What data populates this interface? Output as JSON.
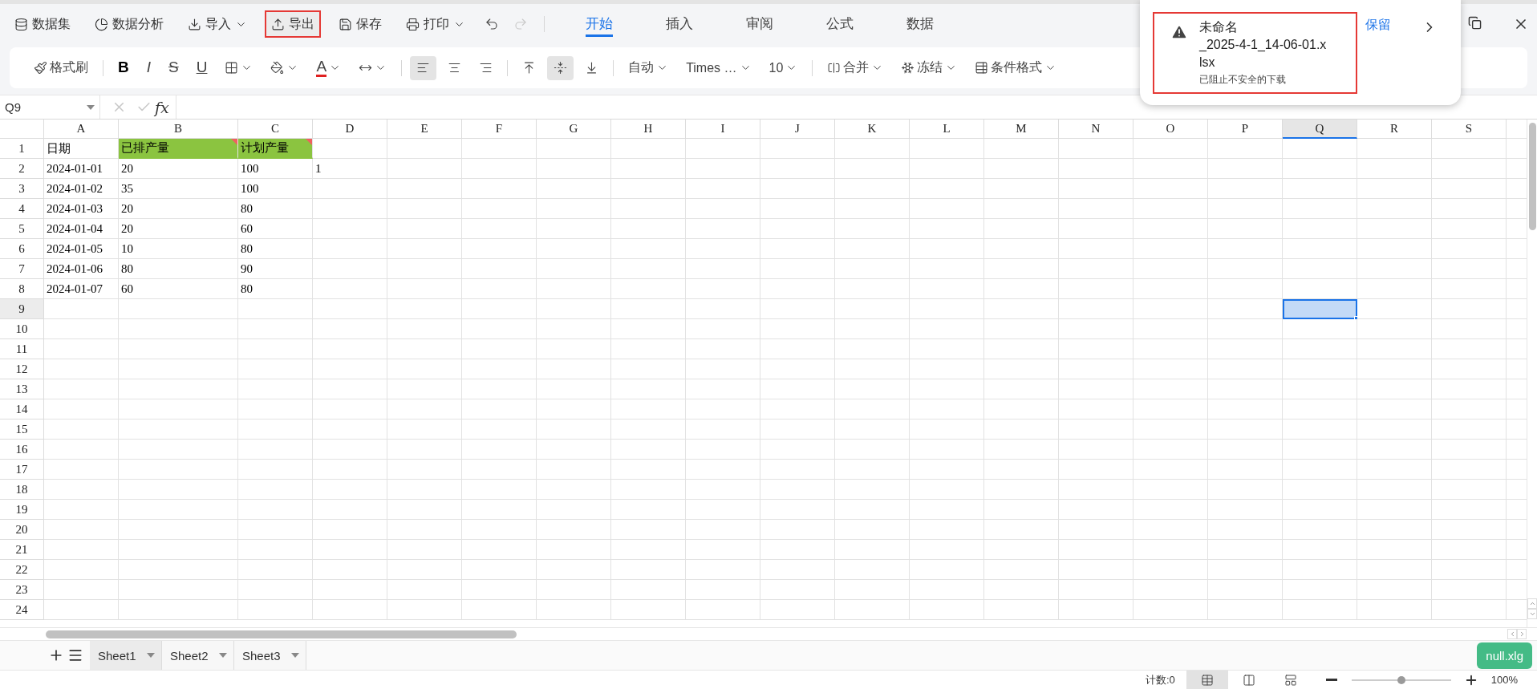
{
  "menu": [
    {
      "kind": "dataset",
      "label": "数据集",
      "dropdown": false,
      "highlighted": false
    },
    {
      "kind": "analysis",
      "label": "数据分析",
      "dropdown": false,
      "highlighted": false
    },
    {
      "kind": "import",
      "label": "导入",
      "dropdown": true,
      "highlighted": false
    },
    {
      "kind": "export",
      "label": "导出",
      "dropdown": false,
      "highlighted": true
    },
    {
      "kind": "save",
      "label": "保存",
      "dropdown": false,
      "highlighted": false
    },
    {
      "kind": "print",
      "label": "打印",
      "dropdown": true,
      "highlighted": false
    }
  ],
  "history": [
    {
      "kind": "undo",
      "disabled": false
    },
    {
      "kind": "redo",
      "disabled": true
    }
  ],
  "tabs": [
    {
      "label": "开始",
      "selected": true
    },
    {
      "label": "插入",
      "selected": false
    },
    {
      "label": "审阅",
      "selected": false
    },
    {
      "label": "公式",
      "selected": false
    },
    {
      "label": "数据",
      "selected": false
    }
  ],
  "toolbar": [
    [
      {
        "kind": "format-painter",
        "label": "格式刷"
      }
    ],
    [
      {
        "kind": "bold",
        "label": "B"
      },
      {
        "kind": "italic",
        "label": "I"
      },
      {
        "kind": "strike",
        "label": "S"
      },
      {
        "kind": "underline",
        "label": "U"
      },
      {
        "kind": "border",
        "dropdown": true
      },
      {
        "kind": "fill",
        "dropdown": true
      },
      {
        "kind": "font-color",
        "label": "A",
        "dropdown": true
      },
      {
        "kind": "spacing",
        "dropdown": true
      }
    ],
    [
      {
        "kind": "align-left",
        "selected": true
      },
      {
        "kind": "align-center",
        "selected": false
      },
      {
        "kind": "align-right",
        "selected": false
      }
    ],
    [
      {
        "kind": "valign-top",
        "selected": false
      },
      {
        "kind": "valign-middle",
        "selected": true
      },
      {
        "kind": "valign-bottom",
        "selected": false
      }
    ],
    [
      {
        "kind": "select",
        "label": "自动",
        "dropdown": true
      },
      {
        "kind": "select",
        "label": "Times …",
        "dropdown": true
      },
      {
        "kind": "select",
        "label": "10",
        "dropdown": true
      }
    ],
    [
      {
        "kind": "merge",
        "label": "合并",
        "dropdown": true
      },
      {
        "kind": "freeze",
        "label": "冻结",
        "dropdown": true
      },
      {
        "kind": "conditional",
        "label": "条件格式",
        "dropdown": true
      }
    ]
  ],
  "formula_bar": {
    "cell_ref": "Q9",
    "fx": "fx"
  },
  "sheet": {
    "columns": [
      {
        "label": "A",
        "selected": false
      },
      {
        "label": "B",
        "selected": false
      },
      {
        "label": "C",
        "selected": false
      },
      {
        "label": "D",
        "selected": false
      },
      {
        "label": "E",
        "selected": false
      },
      {
        "label": "F",
        "selected": false
      },
      {
        "label": "G",
        "selected": false
      },
      {
        "label": "H",
        "selected": false
      },
      {
        "label": "I",
        "selected": false
      },
      {
        "label": "J",
        "selected": false
      },
      {
        "label": "K",
        "selected": false
      },
      {
        "label": "L",
        "selected": false
      },
      {
        "label": "M",
        "selected": false
      },
      {
        "label": "N",
        "selected": false
      },
      {
        "label": "O",
        "selected": false
      },
      {
        "label": "P",
        "selected": false
      },
      {
        "label": "Q",
        "selected": true
      },
      {
        "label": "R",
        "selected": false
      },
      {
        "label": "S",
        "selected": false
      }
    ],
    "rows": [
      {
        "label": "1",
        "selected": false,
        "cells": [
          {
            "text": "日期",
            "highlighted": false
          },
          {
            "text": "已排产量",
            "highlighted": true
          },
          {
            "text": "计划产量",
            "highlighted": true
          }
        ]
      },
      {
        "label": "2",
        "selected": false,
        "cells": [
          {
            "text": "2024-01-01",
            "highlighted": false
          },
          {
            "text": "20",
            "highlighted": false
          },
          {
            "text": "100",
            "highlighted": false
          },
          {
            "text": "1",
            "highlighted": false
          }
        ]
      },
      {
        "label": "3",
        "selected": false,
        "cells": [
          {
            "text": "2024-01-02",
            "highlighted": false
          },
          {
            "text": "35",
            "highlighted": false
          },
          {
            "text": "100",
            "highlighted": false
          }
        ]
      },
      {
        "label": "4",
        "selected": false,
        "cells": [
          {
            "text": "2024-01-03",
            "highlighted": false
          },
          {
            "text": "20",
            "highlighted": false
          },
          {
            "text": "80",
            "highlighted": false
          }
        ]
      },
      {
        "label": "5",
        "selected": false,
        "cells": [
          {
            "text": "2024-01-04",
            "highlighted": false
          },
          {
            "text": "20",
            "highlighted": false
          },
          {
            "text": "60",
            "highlighted": false
          }
        ]
      },
      {
        "label": "6",
        "selected": false,
        "cells": [
          {
            "text": "2024-01-05",
            "highlighted": false
          },
          {
            "text": "10",
            "highlighted": false
          },
          {
            "text": "80",
            "highlighted": false
          }
        ]
      },
      {
        "label": "7",
        "selected": false,
        "cells": [
          {
            "text": "2024-01-06",
            "highlighted": false
          },
          {
            "text": "80",
            "highlighted": false
          },
          {
            "text": "90",
            "highlighted": false
          }
        ]
      },
      {
        "label": "8",
        "selected": false,
        "cells": [
          {
            "text": "2024-01-07",
            "highlighted": false
          },
          {
            "text": "60",
            "highlighted": false
          },
          {
            "text": "80",
            "highlighted": false
          }
        ]
      },
      {
        "label": "9",
        "selected": true,
        "cells": []
      },
      {
        "label": "10",
        "selected": false,
        "cells": []
      },
      {
        "label": "11",
        "selected": false,
        "cells": []
      },
      {
        "label": "12",
        "selected": false,
        "cells": []
      },
      {
        "label": "13",
        "selected": false,
        "cells": []
      },
      {
        "label": "14",
        "selected": false,
        "cells": []
      },
      {
        "label": "15",
        "selected": false,
        "cells": []
      },
      {
        "label": "16",
        "selected": false,
        "cells": []
      },
      {
        "label": "17",
        "selected": false,
        "cells": []
      },
      {
        "label": "18",
        "selected": false,
        "cells": []
      },
      {
        "label": "19",
        "selected": false,
        "cells": []
      },
      {
        "label": "20",
        "selected": false,
        "cells": []
      },
      {
        "label": "21",
        "selected": false,
        "cells": []
      },
      {
        "label": "22",
        "selected": false,
        "cells": []
      },
      {
        "label": "23",
        "selected": false,
        "cells": []
      },
      {
        "label": "24",
        "selected": false,
        "cells": []
      }
    ]
  },
  "sheet_tabs": [
    {
      "label": "Sheet1",
      "selected": true
    },
    {
      "label": "Sheet2",
      "selected": false
    },
    {
      "label": "Sheet3",
      "selected": false
    }
  ],
  "file_badge": "null.xlg",
  "status_bar": {
    "count": "计数:0",
    "views": [
      {
        "kind": "normal",
        "selected": true
      },
      {
        "kind": "page-break",
        "selected": false
      },
      {
        "kind": "page-layout",
        "selected": false
      }
    ],
    "zoom": {
      "level": 0.5,
      "label": "100%"
    }
  },
  "download_popup": {
    "filename_lines": [
      "未命名",
      "_2025-4-1_14-06-01.x",
      "lsx"
    ],
    "status": "已阻止不安全的下载",
    "action": "保留",
    "highlighted": true
  }
}
